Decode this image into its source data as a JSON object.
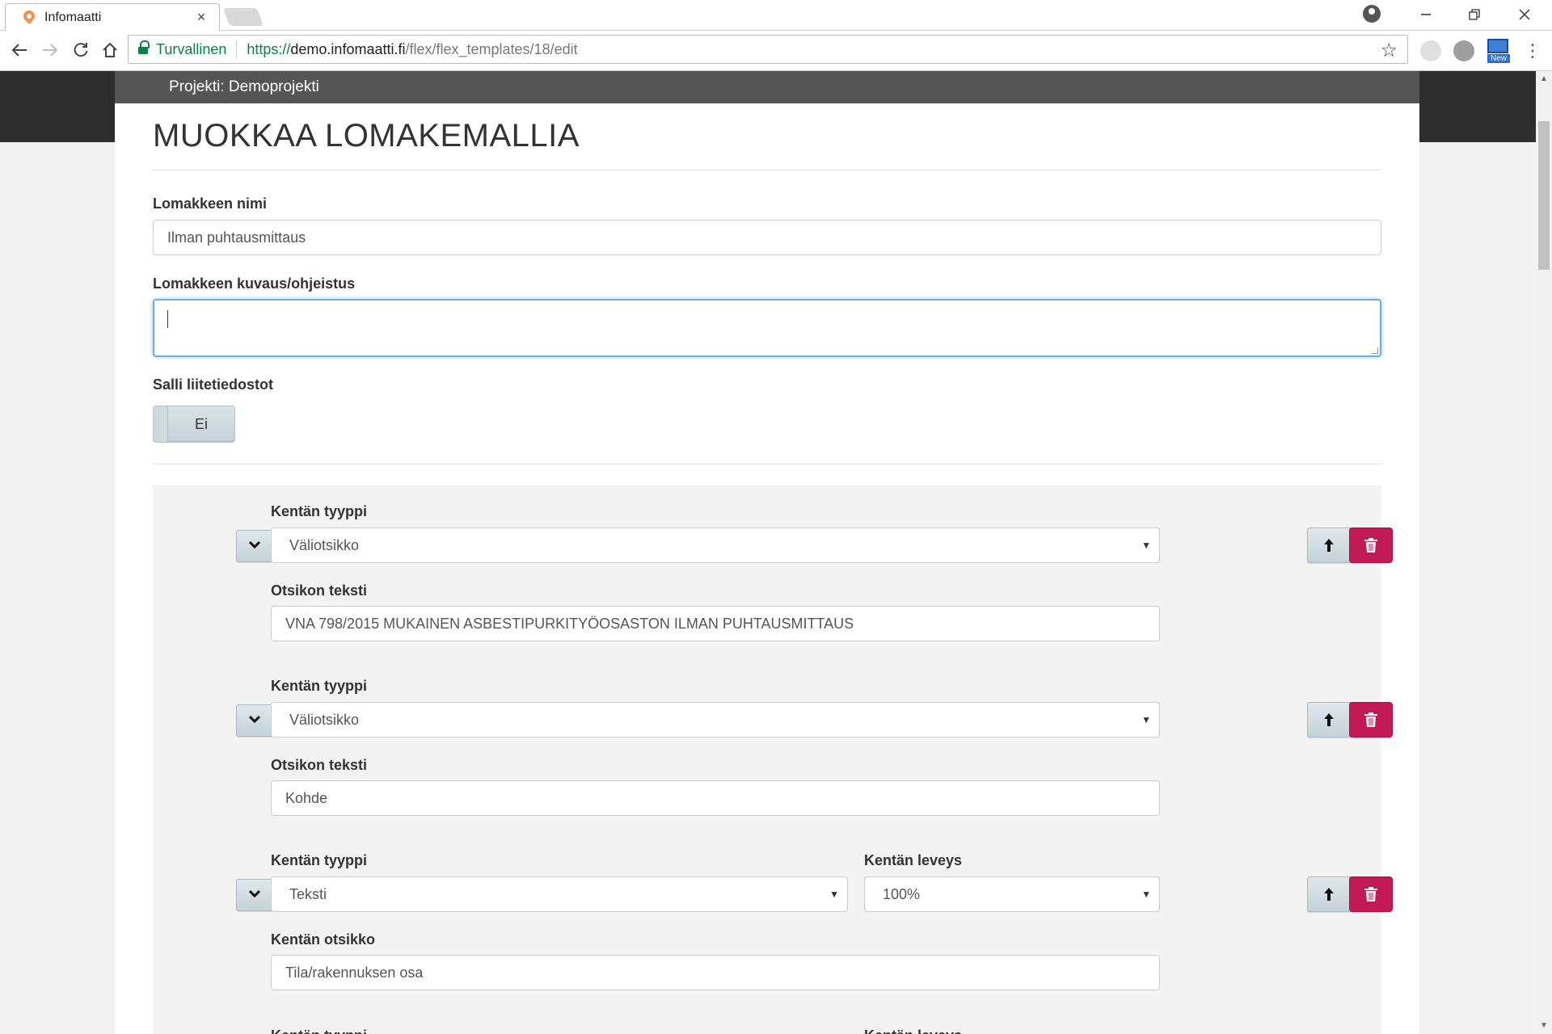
{
  "browser": {
    "tab_title": "Infomaatti",
    "tab_close": "×",
    "secure_label": "Turvallinen",
    "url_scheme": "https://",
    "url_host": "demo.infomaatti.fi",
    "url_path": "/flex/flex_templates/18/edit",
    "ext_new_label": "New"
  },
  "header": {
    "project": "Projekti: Demoprojekti",
    "page_title": "MUOKKAA LOMAKEMALLIA"
  },
  "form": {
    "name_label": "Lomakkeen nimi",
    "name_value": "Ilman puhtausmittaus",
    "description_label": "Lomakkeen kuvaus/ohjeistus",
    "description_value": "",
    "attachments_label": "Salli liitetiedostot",
    "attachments_value": "Ei"
  },
  "fields": [
    {
      "type_label": "Kentän tyyppi",
      "type_value": "Väliotsikko",
      "text_label": "Otsikon teksti",
      "text_value": "VNA 798/2015 MUKAINEN ASBESTIPURKITYÖOSASTON ILMAN PUHTAUSMITTAUS"
    },
    {
      "type_label": "Kentän tyyppi",
      "type_value": "Väliotsikko",
      "text_label": "Otsikon teksti",
      "text_value": "Kohde"
    },
    {
      "type_label": "Kentän tyyppi",
      "type_value": "Teksti",
      "width_label": "Kentän leveys",
      "width_value": "100%",
      "text_label": "Kentän otsikko",
      "text_value": "Tila/rakennuksen osa"
    },
    {
      "type_label": "Kentän tyyppi",
      "width_label": "Kentän leveys"
    }
  ],
  "colors": {
    "accent_delete": "#c21a55",
    "project_bar": "#555555",
    "secure_green": "#0b8043"
  }
}
